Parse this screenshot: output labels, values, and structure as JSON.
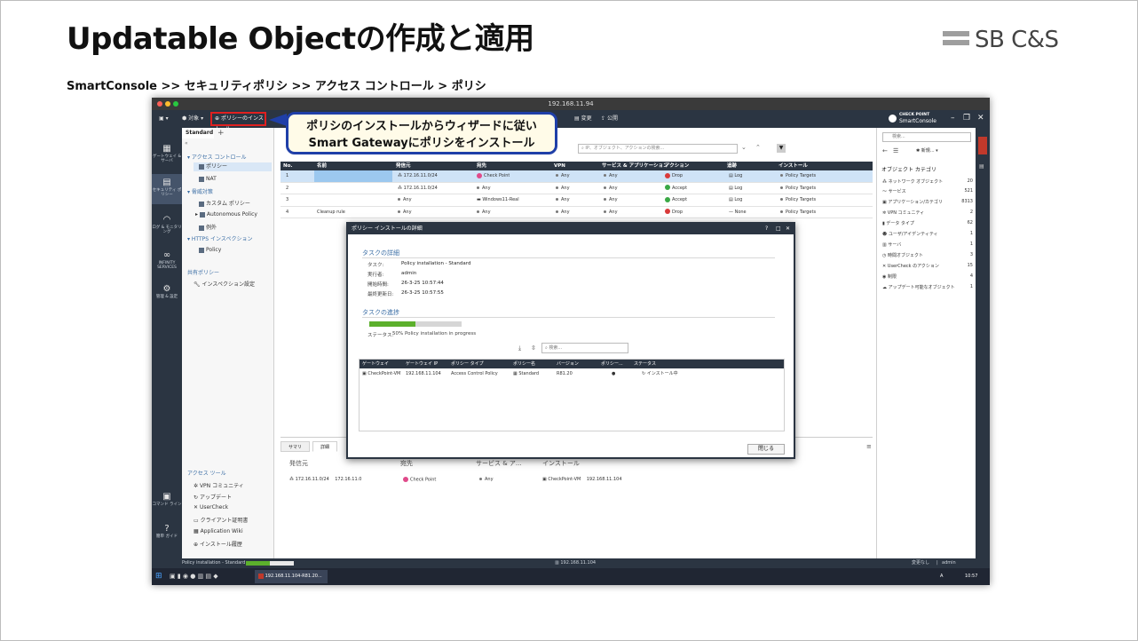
{
  "slide": {
    "title": "Updatable Objectの作成と適用",
    "logo": "SB C&S",
    "breadcrumb": "SmartConsole >> セキュリティポリシ >> アクセス コントロール > ポリシ"
  },
  "window": {
    "title": "192.168.11.94",
    "toolbar": {
      "objects": "対象",
      "install": "ポリシーのインストール",
      "changes": "変更",
      "publish": "公開"
    },
    "brand_top": "CHECK POINT",
    "brand_bottom": "SmartConsole"
  },
  "callout": {
    "line1": "ポリシのインストールからウィザードに従い",
    "line2": "Smart Gatewayにポリシをインストール"
  },
  "left_nav": [
    {
      "icon": "gateways-icon",
      "label": "ゲートウェイ & サーバ"
    },
    {
      "icon": "security-policy-icon",
      "label": "セキュリティ ポリシー"
    },
    {
      "icon": "logs-icon",
      "label": "ログ & モニタリング"
    },
    {
      "icon": "infinity-icon",
      "label": "INFINITY SERVICES"
    },
    {
      "icon": "manage-icon",
      "label": "管理 & 設定"
    },
    {
      "icon": "command-line-icon",
      "label": "コマンド ライン"
    },
    {
      "icon": "help-icon",
      "label": "簡単 ガイド"
    }
  ],
  "tree": {
    "tab": "Standard",
    "access_control": "アクセス コントロール",
    "policy": "ポリシー",
    "nat": "NAT",
    "threat": "脅威対策",
    "custom_policy": "カスタム ポリシー",
    "autonomous": "Autonomous Policy",
    "exceptions": "例外",
    "https": "HTTPS インスペクション",
    "https_policy": "Policy",
    "shared": "共有ポリシー",
    "inspection": "インスペクション設定",
    "tools_head": "アクセス ツール",
    "tools": [
      "VPN コミュニティ",
      "アップデート",
      "UserCheck",
      "クライアント証明書",
      "Application Wiki",
      "インストール履歴"
    ]
  },
  "search": {
    "placeholder": "IP、オブジェクト、アクションの検索..."
  },
  "grid": {
    "headers": [
      "No.",
      "名前",
      "発信元",
      "宛先",
      "VPN",
      "サービス & アプリケーション",
      "アクション",
      "追跡",
      "インストール"
    ],
    "rows": [
      {
        "no": "1",
        "name": "",
        "src": "172.16.11.0/24",
        "dst": "Check Point",
        "vpn": "Any",
        "svc": "Any",
        "action": "Drop",
        "track": "Log",
        "install": "Policy Targets"
      },
      {
        "no": "2",
        "name": "",
        "src": "172.16.11.0/24",
        "dst": "Any",
        "vpn": "Any",
        "svc": "Any",
        "action": "Accept",
        "track": "Log",
        "install": "Policy Targets"
      },
      {
        "no": "3",
        "name": "",
        "src": "Any",
        "dst": "Windows11-Real",
        "vpn": "Any",
        "svc": "Any",
        "action": "Accept",
        "track": "Log",
        "install": "Policy Targets"
      },
      {
        "no": "4",
        "name": "Cleanup rule",
        "src": "Any",
        "dst": "Any",
        "vpn": "Any",
        "svc": "Any",
        "action": "Drop",
        "track": "None",
        "install": "Policy Targets"
      }
    ]
  },
  "bottom": {
    "tabs": [
      "サマリ",
      "詳細"
    ],
    "cols": [
      "発信元",
      "宛先",
      "サービス & ア...",
      "インストール"
    ],
    "src_vals": [
      "172.16.11.0/24",
      "172.16.11.0"
    ],
    "dst_val": "Check Point",
    "svc_val": "Any",
    "inst_vals": [
      "CheckPoint-VM",
      "192.168.11.104"
    ]
  },
  "right_panel": {
    "search_placeholder": "検索...",
    "new_label": "新規...",
    "title": "オブジェクト カテゴリ",
    "items": [
      {
        "label": "ネットワーク オブジェクト",
        "count": "20"
      },
      {
        "label": "サービス",
        "count": "521"
      },
      {
        "label": "アプリケーション/カテゴリ",
        "count": "8313"
      },
      {
        "label": "VPN コミュニティ",
        "count": "2"
      },
      {
        "label": "データ タイプ",
        "count": "62"
      },
      {
        "label": "ユーザ/アイデンティティ",
        "count": "1"
      },
      {
        "label": "サーバ",
        "count": "1"
      },
      {
        "label": "時間オブジェクト",
        "count": "3"
      },
      {
        "label": "UserCheck のアクション",
        "count": "15"
      },
      {
        "label": "制限",
        "count": "4"
      },
      {
        "label": "アップデート可能なオブジェクト",
        "count": "1"
      }
    ]
  },
  "dialog": {
    "title": "ポリシー インストールの詳細",
    "task_details": "タスクの詳細",
    "labels": {
      "task": "タスク:",
      "executor": "実行者:",
      "start": "開始時間:",
      "updated": "最終更新日:"
    },
    "values": {
      "task": "Policy installation - Standard",
      "executor": "admin",
      "start": "26-3-25 10:57:44",
      "updated": "26-3-25 10:57:55"
    },
    "progress_title": "タスクの進捗",
    "progress": 0.5,
    "status_label": "ステータス:",
    "status_text": "50%  Policy installation in progress",
    "search_placeholder": "検索...",
    "grid_headers": [
      "ゲートウェイ",
      "ゲートウェイ IP",
      "ポリシー タイプ",
      "ポリシー名",
      "バージョン",
      "ポリシー...",
      "ステータス"
    ],
    "grid_row": {
      "gw": "CheckPoint-VM",
      "ip": "192.168.11.104",
      "type": "Access Control Policy",
      "name": "Standard",
      "ver": "R81.20",
      "status": "インストール中"
    },
    "close": "閉じる"
  },
  "status": {
    "left": "Policy installation - Standard",
    "center": "192.168.11.104",
    "right_changes": "変更なし",
    "right_user": "admin"
  },
  "taskbar": {
    "app": "192.168.11.104-R81.20...",
    "lang": "A",
    "time": "10:57"
  }
}
